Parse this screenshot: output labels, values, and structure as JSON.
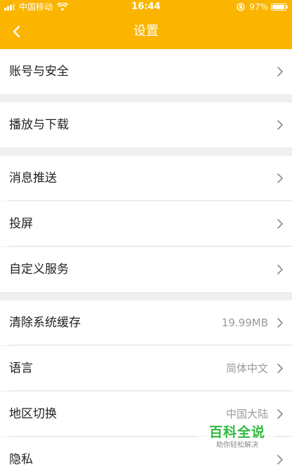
{
  "status_bar": {
    "carrier": "中国移动",
    "time": "16:44",
    "battery_percent": "97%",
    "battery_level": 0.97
  },
  "nav": {
    "title": "设置"
  },
  "settings": {
    "account_security": {
      "label": "账号与安全"
    },
    "play_download": {
      "label": "播放与下载"
    },
    "push_notifications": {
      "label": "消息推送"
    },
    "screen_cast": {
      "label": "投屏"
    },
    "custom_services": {
      "label": "自定义服务"
    },
    "clear_cache": {
      "label": "清除系统缓存",
      "value": "19.99MB"
    },
    "language": {
      "label": "语言",
      "value": "简体中文"
    },
    "region": {
      "label": "地区切换",
      "value": "中国大陆"
    },
    "privacy": {
      "label": "隐私"
    }
  },
  "watermark": {
    "title": "百科全说",
    "subtitle": "助你轻松解决"
  },
  "colors": {
    "accent": "#fbb500",
    "background": "#efefef",
    "row": "#ffffff",
    "label": "#222222",
    "value": "#9a9a9a",
    "watermark": "#2fbb3d"
  }
}
